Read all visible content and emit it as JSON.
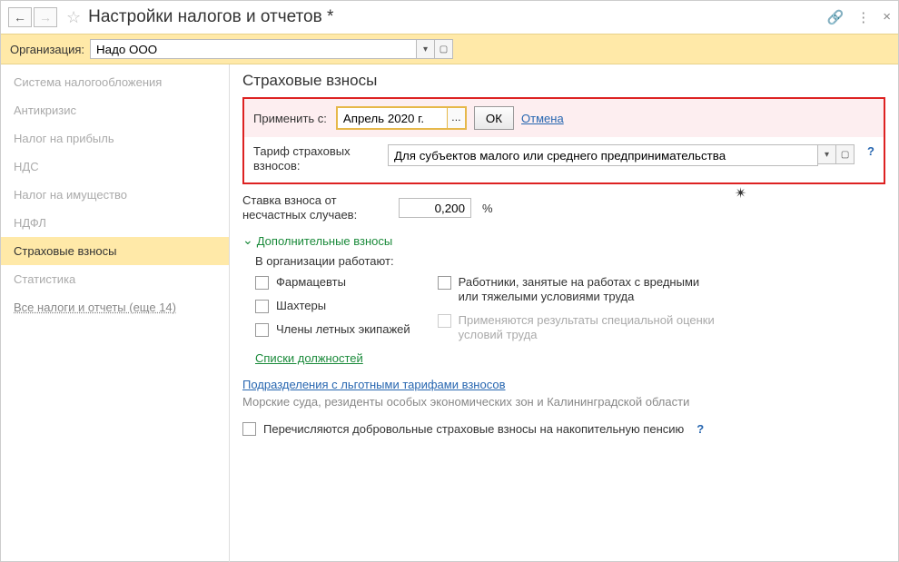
{
  "title": "Настройки налогов и отчетов *",
  "org": {
    "label": "Организация:",
    "value": "Надо ООО"
  },
  "sidebar": {
    "items": [
      "Система налогообложения",
      "Антикризис",
      "Налог на прибыль",
      "НДС",
      "Налог на имущество",
      "НДФЛ",
      "Страховые взносы",
      "Статистика"
    ],
    "link": "Все налоги и отчеты (еще 14)"
  },
  "content": {
    "heading": "Страховые взносы",
    "apply": {
      "label": "Применить с:",
      "value": "Апрель 2020 г.",
      "ok": "ОК",
      "cancel": "Отмена"
    },
    "tariff": {
      "label": "Тариф страховых взносов:",
      "value": "Для субъектов малого или среднего предпринимательства"
    },
    "rate": {
      "label": "Ставка взноса от несчастных случаев:",
      "value": "0,200",
      "unit": "%"
    },
    "extra": {
      "title": "Дополнительные взносы",
      "subtitle": "В организации работают:",
      "left": [
        "Фармацевты",
        "Шахтеры",
        "Члены летных экипажей"
      ],
      "right": [
        "Работники, занятые на работах с вредными или тяжелыми условиями труда",
        "Применяются результаты специальной оценки условий труда"
      ],
      "listLink": "Списки должностей"
    },
    "divisionsLink": "Подразделения с льготными тарифами взносов",
    "info": "Морские суда, резиденты особых экономических зон и Калининградской области",
    "voluntary": "Перечисляются добровольные страховые взносы на накопительную пенсию",
    "help": "?"
  }
}
